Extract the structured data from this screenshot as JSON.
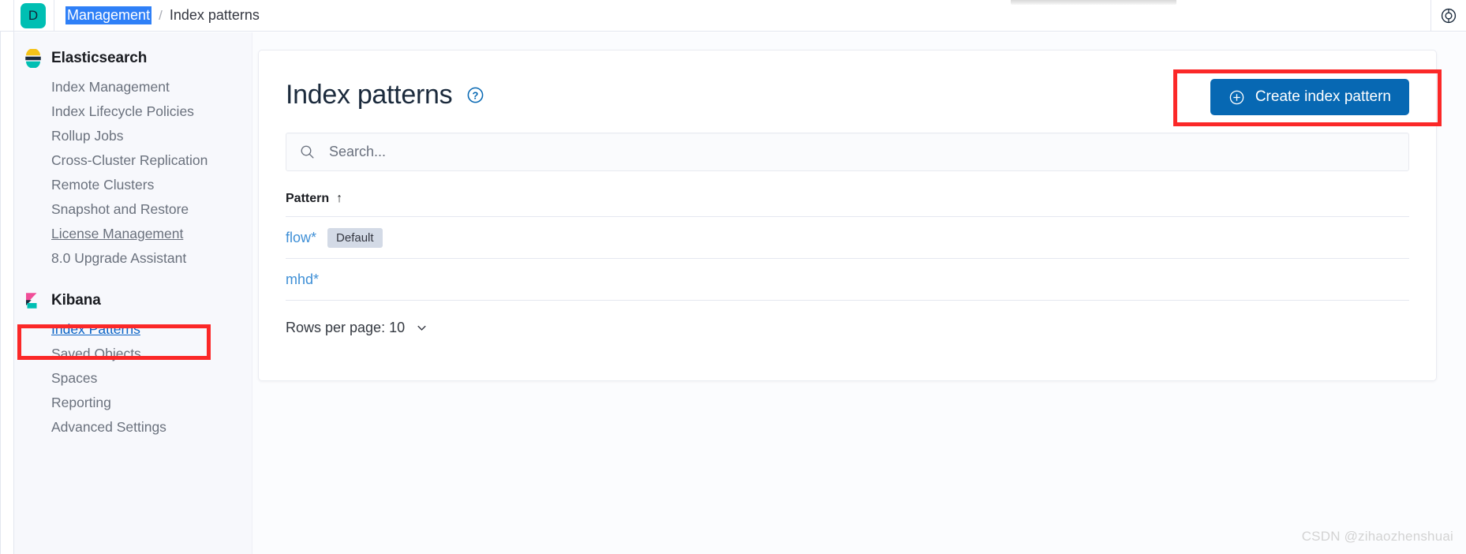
{
  "topbar": {
    "avatar_letter": "D",
    "breadcrumb": {
      "selected": "Management",
      "separator": "/",
      "current": "Index patterns"
    },
    "help_icon": "lifebuoy-icon"
  },
  "sidebar": {
    "groups": [
      {
        "title": "Elasticsearch",
        "logo": "elasticsearch-logo",
        "items": [
          {
            "label": "Index Management",
            "state": "normal"
          },
          {
            "label": "Index Lifecycle Policies",
            "state": "normal"
          },
          {
            "label": "Rollup Jobs",
            "state": "normal"
          },
          {
            "label": "Cross-Cluster Replication",
            "state": "normal"
          },
          {
            "label": "Remote Clusters",
            "state": "normal"
          },
          {
            "label": "Snapshot and Restore",
            "state": "normal"
          },
          {
            "label": "License Management",
            "state": "underline"
          },
          {
            "label": "8.0 Upgrade Assistant",
            "state": "normal"
          }
        ]
      },
      {
        "title": "Kibana",
        "logo": "kibana-logo",
        "items": [
          {
            "label": "Index Patterns",
            "state": "active"
          },
          {
            "label": "Saved Objects",
            "state": "normal"
          },
          {
            "label": "Spaces",
            "state": "normal"
          },
          {
            "label": "Reporting",
            "state": "normal"
          },
          {
            "label": "Advanced Settings",
            "state": "normal"
          }
        ]
      }
    ]
  },
  "main": {
    "page_title": "Index patterns",
    "title_help_icon": "question-mark-circle-icon",
    "create_button": {
      "label": "Create index pattern",
      "icon": "plus-in-circle-icon",
      "color": "#0768b3"
    },
    "search": {
      "placeholder": "Search...",
      "value": "",
      "icon": "search-icon"
    },
    "table": {
      "columns": [
        "Pattern"
      ],
      "sort_column": "Pattern",
      "sort_direction": "ascending",
      "sort_icon": "↑",
      "rows": [
        {
          "pattern": "flow*",
          "badge": "Default"
        },
        {
          "pattern": "mhd*",
          "badge": ""
        }
      ]
    },
    "pagination": {
      "rows_per_page_label": "Rows per page: 10",
      "chevron_icon": "chevron-down-icon"
    }
  },
  "annotations": {
    "highlight_color": "#fb2828",
    "boxes": [
      "create-index-pattern-button",
      "sidebar-index-patterns"
    ]
  },
  "watermark": {
    "text": "CSDN @zihaozhenshuai"
  }
}
